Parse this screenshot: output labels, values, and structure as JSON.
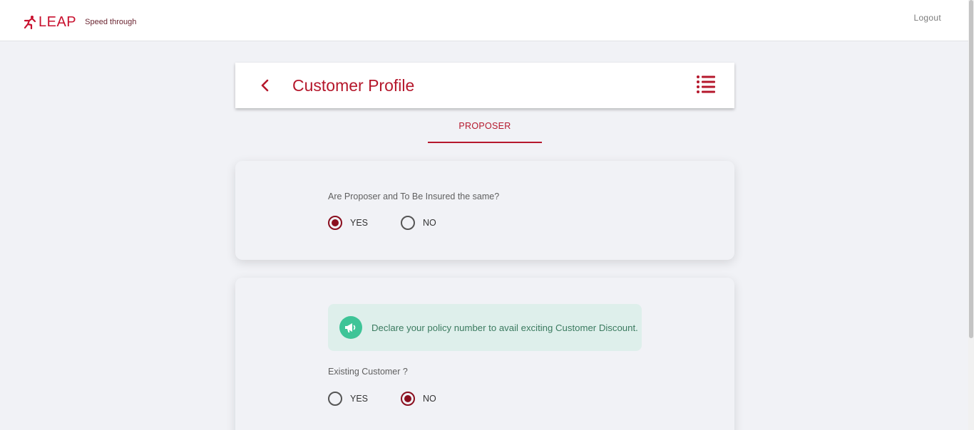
{
  "app": {
    "logo_text": "LEAP",
    "tagline": "Speed through",
    "logout_label": "Logout"
  },
  "header": {
    "title": "Customer Profile"
  },
  "tabs": [
    {
      "label": "PROPOSER",
      "active": true
    }
  ],
  "proposer_section": {
    "question": "Are Proposer and To Be Insured the same?",
    "options": [
      {
        "label": "YES",
        "selected": true
      },
      {
        "label": "NO",
        "selected": false
      }
    ]
  },
  "customer_section": {
    "banner_text": "Declare your policy number to avail exciting Customer Discount.",
    "banner_icon": "megaphone-icon",
    "question": "Existing Customer ?",
    "options": [
      {
        "label": "YES",
        "selected": false
      },
      {
        "label": "NO",
        "selected": true
      }
    ]
  },
  "colors": {
    "brand": "#c8102e",
    "title": "#b5182c",
    "radio_selected": "#8a0e1e",
    "banner_bg": "#deefeb",
    "banner_icon_bg": "#3ec497",
    "page_bg": "#f1f2f6"
  }
}
